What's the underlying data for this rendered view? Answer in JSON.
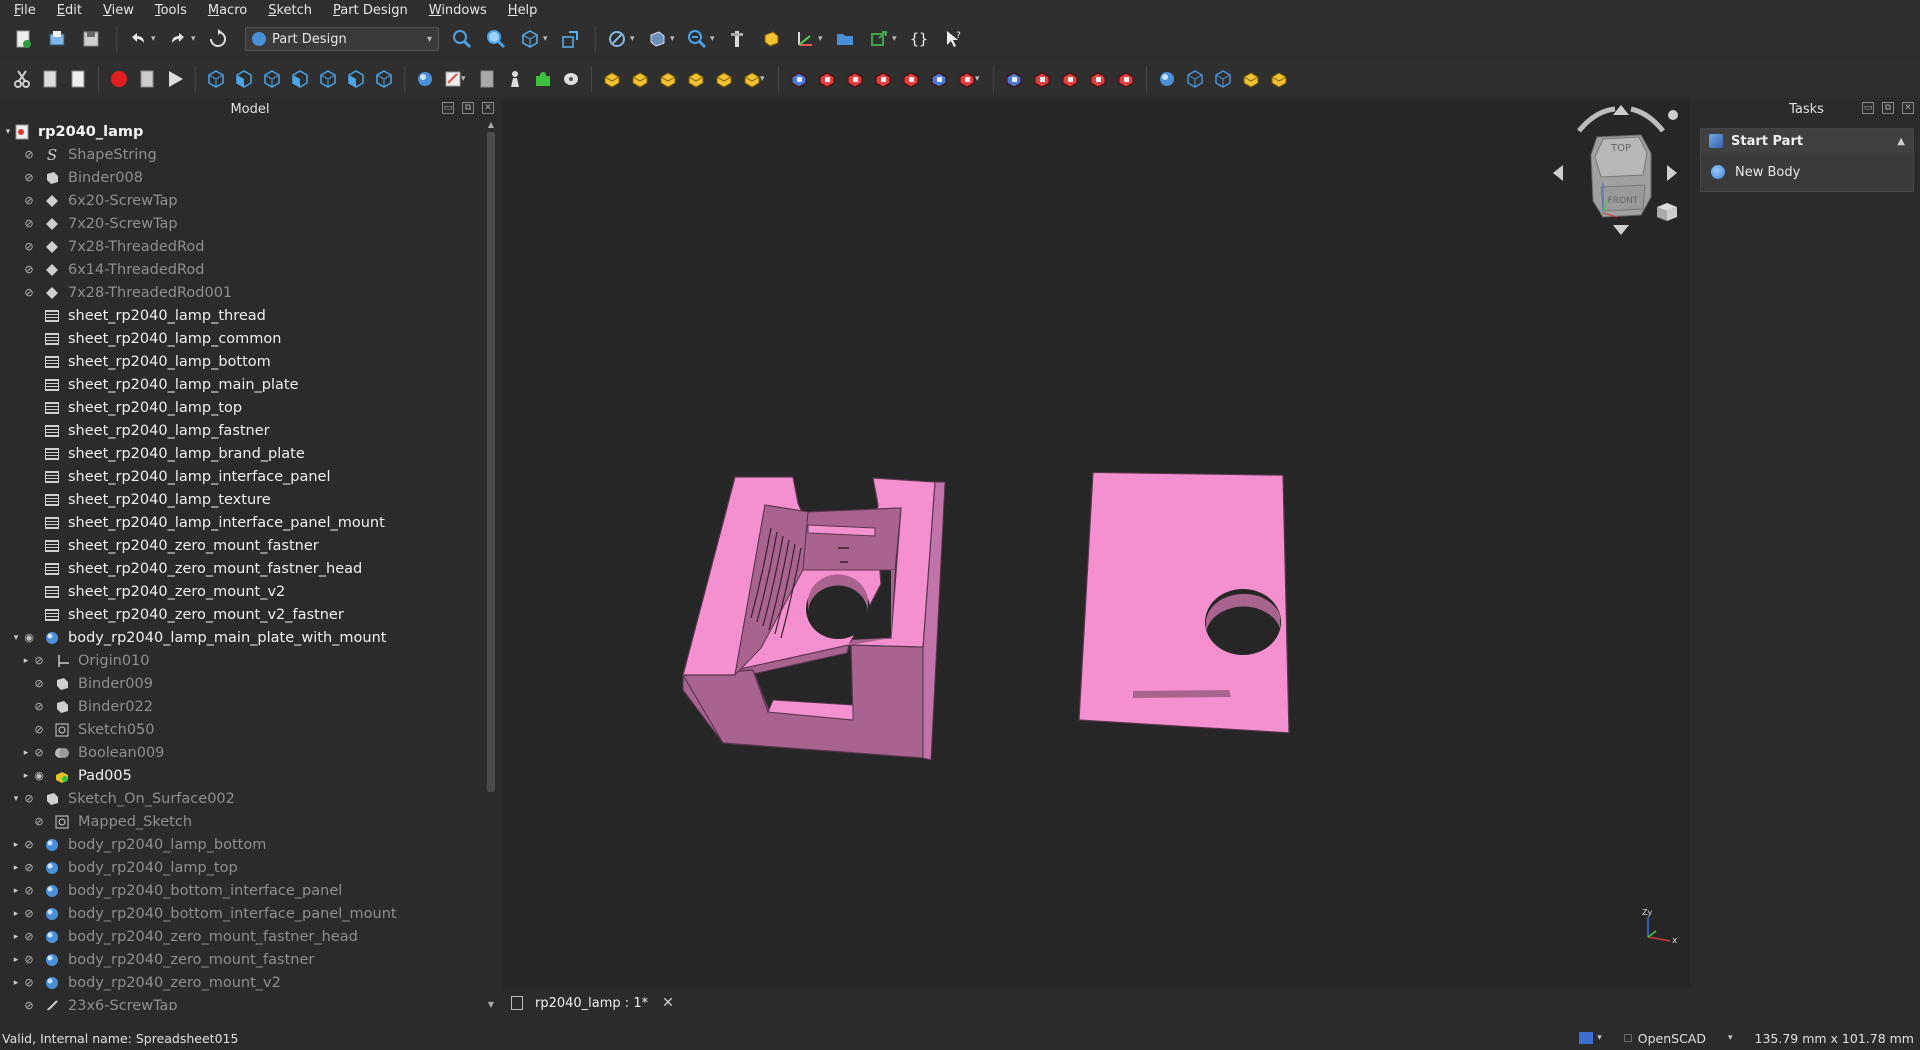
{
  "menu": [
    "File",
    "Edit",
    "View",
    "Tools",
    "Macro",
    "Sketch",
    "Part Design",
    "Windows",
    "Help"
  ],
  "workbench": {
    "selected": "Part Design"
  },
  "model_panel": {
    "title": "Model"
  },
  "tree": [
    {
      "label": "rp2040_lamp",
      "depth": 0,
      "expander": "open",
      "eye": "",
      "icon": "doc",
      "style": "bold"
    },
    {
      "label": "ShapeString",
      "depth": 1,
      "expander": "",
      "eye": "hidden",
      "icon": "S",
      "style": "dim"
    },
    {
      "label": "Binder008",
      "depth": 1,
      "expander": "",
      "eye": "hidden",
      "icon": "binder",
      "style": "dim"
    },
    {
      "label": "6x20-ScrewTap",
      "depth": 1,
      "expander": "",
      "eye": "hidden",
      "icon": "diamond",
      "style": "dim"
    },
    {
      "label": "7x20-ScrewTap",
      "depth": 1,
      "expander": "",
      "eye": "hidden",
      "icon": "diamond",
      "style": "dim"
    },
    {
      "label": "7x28-ThreadedRod",
      "depth": 1,
      "expander": "",
      "eye": "hidden",
      "icon": "diamond",
      "style": "dim"
    },
    {
      "label": "6x14-ThreadedRod",
      "depth": 1,
      "expander": "",
      "eye": "hidden",
      "icon": "diamond",
      "style": "dim"
    },
    {
      "label": "7x28-ThreadedRod001",
      "depth": 1,
      "expander": "",
      "eye": "hidden",
      "icon": "diamond",
      "style": "dim"
    },
    {
      "label": "sheet_rp2040_lamp_thread",
      "depth": 1,
      "expander": "",
      "eye": "none",
      "icon": "sheet",
      "style": "bright"
    },
    {
      "label": "sheet_rp2040_lamp_common",
      "depth": 1,
      "expander": "",
      "eye": "none",
      "icon": "sheet",
      "style": "bright"
    },
    {
      "label": "sheet_rp2040_lamp_bottom",
      "depth": 1,
      "expander": "",
      "eye": "none",
      "icon": "sheet",
      "style": "bright"
    },
    {
      "label": "sheet_rp2040_lamp_main_plate",
      "depth": 1,
      "expander": "",
      "eye": "none",
      "icon": "sheet",
      "style": "bright"
    },
    {
      "label": "sheet_rp2040_lamp_top",
      "depth": 1,
      "expander": "",
      "eye": "none",
      "icon": "sheet",
      "style": "bright"
    },
    {
      "label": "sheet_rp2040_lamp_fastner",
      "depth": 1,
      "expander": "",
      "eye": "none",
      "icon": "sheet",
      "style": "bright"
    },
    {
      "label": "sheet_rp2040_lamp_brand_plate",
      "depth": 1,
      "expander": "",
      "eye": "none",
      "icon": "sheet",
      "style": "bright"
    },
    {
      "label": "sheet_rp2040_lamp_interface_panel",
      "depth": 1,
      "expander": "",
      "eye": "none",
      "icon": "sheet",
      "style": "bright"
    },
    {
      "label": "sheet_rp2040_lamp_texture",
      "depth": 1,
      "expander": "",
      "eye": "none",
      "icon": "sheet",
      "style": "bright"
    },
    {
      "label": "sheet_rp2040_lamp_interface_panel_mount",
      "depth": 1,
      "expander": "",
      "eye": "none",
      "icon": "sheet",
      "style": "bright"
    },
    {
      "label": "sheet_rp2040_zero_mount_fastner",
      "depth": 1,
      "expander": "",
      "eye": "none",
      "icon": "sheet",
      "style": "bright"
    },
    {
      "label": "sheet_rp2040_zero_mount_fastner_head",
      "depth": 1,
      "expander": "",
      "eye": "none",
      "icon": "sheet",
      "style": "bright"
    },
    {
      "label": "sheet_rp2040_zero_mount_v2",
      "depth": 1,
      "expander": "",
      "eye": "none",
      "icon": "sheet",
      "style": "bright"
    },
    {
      "label": "sheet_rp2040_zero_mount_v2_fastner",
      "depth": 1,
      "expander": "",
      "eye": "none",
      "icon": "sheet",
      "style": "bright"
    },
    {
      "label": "body_rp2040_lamp_main_plate_with_mount",
      "depth": 1,
      "expander": "open",
      "eye": "visible",
      "icon": "body",
      "style": "bright"
    },
    {
      "label": "Origin010",
      "depth": 2,
      "expander": "closed",
      "eye": "hidden",
      "icon": "origin",
      "style": "dim"
    },
    {
      "label": "Binder009",
      "depth": 2,
      "expander": "",
      "eye": "hidden",
      "icon": "binder",
      "style": "dim"
    },
    {
      "label": "Binder022",
      "depth": 2,
      "expander": "",
      "eye": "hidden",
      "icon": "binder",
      "style": "dim"
    },
    {
      "label": "Sketch050",
      "depth": 2,
      "expander": "",
      "eye": "hidden",
      "icon": "sketch",
      "style": "dim"
    },
    {
      "label": "Boolean009",
      "depth": 2,
      "expander": "closed",
      "eye": "hidden",
      "icon": "boolean",
      "style": "dim"
    },
    {
      "label": "Pad005",
      "depth": 2,
      "expander": "closed",
      "eye": "visible",
      "icon": "pad",
      "style": "bright"
    },
    {
      "label": "Sketch_On_Surface002",
      "depth": 1,
      "expander": "open",
      "eye": "hidden",
      "icon": "binder",
      "style": "dim"
    },
    {
      "label": "Mapped_Sketch",
      "depth": 2,
      "expander": "",
      "eye": "hidden",
      "icon": "sketch",
      "style": "dim"
    },
    {
      "label": "body_rp2040_lamp_bottom",
      "depth": 1,
      "expander": "closed",
      "eye": "hidden",
      "icon": "body",
      "style": "dim"
    },
    {
      "label": "body_rp2040_lamp_top",
      "depth": 1,
      "expander": "closed",
      "eye": "hidden",
      "icon": "body",
      "style": "dim"
    },
    {
      "label": "body_rp2040_bottom_interface_panel",
      "depth": 1,
      "expander": "closed",
      "eye": "hidden",
      "icon": "body",
      "style": "dim"
    },
    {
      "label": "body_rp2040_bottom_interface_panel_mount",
      "depth": 1,
      "expander": "closed",
      "eye": "hidden",
      "icon": "body",
      "style": "dim"
    },
    {
      "label": "body_rp2040_zero_mount_fastner_head",
      "depth": 1,
      "expander": "closed",
      "eye": "hidden",
      "icon": "body",
      "style": "dim"
    },
    {
      "label": "body_rp2040_zero_mount_fastner",
      "depth": 1,
      "expander": "closed",
      "eye": "hidden",
      "icon": "body",
      "style": "dim"
    },
    {
      "label": "body_rp2040_zero_mount_v2",
      "depth": 1,
      "expander": "closed",
      "eye": "hidden",
      "icon": "body",
      "style": "dim"
    },
    {
      "label": "23x6-ScrewTap",
      "depth": 1,
      "expander": "",
      "eye": "hidden",
      "icon": "pen",
      "style": "dim"
    }
  ],
  "navcube": {
    "top": "TOP",
    "front": "FRONT"
  },
  "axis": {
    "zy": "Zy",
    "x": "x"
  },
  "doc_tab": {
    "label": "rp2040_lamp : 1*"
  },
  "tasks": {
    "title": "Tasks",
    "section": "Start Part",
    "item": "New Body"
  },
  "status": {
    "message": "Valid, Internal name: Spreadsheet015",
    "navigation": "OpenSCAD",
    "dimensions": "135.79 mm x 101.78 mm"
  },
  "colors": {
    "part": "#f590d0",
    "part_shade": "#a8638f",
    "part_side": "#c274aa",
    "background": "#262626"
  }
}
